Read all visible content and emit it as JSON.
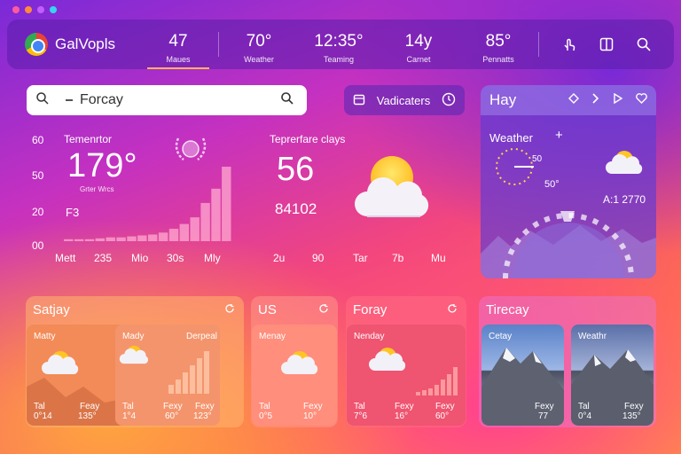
{
  "window_controls": {
    "colors": [
      "#ff5aa0",
      "#ff8a3c",
      "#c45cff",
      "#38d3f0"
    ]
  },
  "header": {
    "brand": "GalVopls",
    "stats": [
      {
        "value": "47",
        "label": "Maues",
        "active": true
      },
      {
        "value": "70°",
        "label": "Weather"
      },
      {
        "value": "12:35°",
        "label": "Teaming"
      },
      {
        "value": "14y",
        "label": "Carnet"
      },
      {
        "value": "85°",
        "label": "Pennatts"
      }
    ],
    "icons": [
      "hand-pointer-icon",
      "panel-icon",
      "search-icon"
    ]
  },
  "search": {
    "value": "Forcay"
  },
  "indicators_button": {
    "label": "Vadicaters"
  },
  "temperature_card": {
    "title": "Temenrtor",
    "value": "179°",
    "caption": "Grter Wrcs",
    "unit_label": "F3",
    "y_ticks": [
      "60",
      "50",
      "20",
      "00"
    ],
    "x_ticks": [
      "Mett",
      "235",
      "Mio",
      "30s",
      "Mly"
    ],
    "bars": [
      2,
      2,
      2,
      3,
      4,
      4,
      5,
      6,
      7,
      9,
      13,
      18,
      25,
      40,
      55,
      78
    ],
    "badge_icon": "laurel-sun-icon"
  },
  "temperature_days": {
    "title": "Teprerfare clays",
    "value": "56",
    "sub": "84102",
    "x_ticks": [
      "2u",
      "90",
      "Tar",
      "7b",
      "Mu"
    ],
    "weather_icon": "partly-cloudy-icon"
  },
  "right_panel": {
    "title": "Hay",
    "subtitle": "Weather",
    "plus": "+",
    "dial_value": "50",
    "dial_value2": "50°",
    "reading": "A:1 2770",
    "icons": [
      "diamond-icon",
      "chevron-right-icon",
      "play-icon",
      "heart-icon"
    ],
    "gauge_level": 0.62
  },
  "cards": [
    {
      "title": "Satjay",
      "panels": [
        {
          "title": "Matty",
          "footer": [
            [
              "Tal",
              "0°14"
            ],
            [
              "Feay",
              "135°"
            ]
          ],
          "accent": "#f08a50"
        },
        {
          "title": "Mady",
          "title2": "Derpeal",
          "footer": [
            [
              "Tal",
              "1°4"
            ],
            [
              "Fexy",
              "60°"
            ],
            [
              "Fexy",
              "123°"
            ]
          ],
          "accent": "#f4926a"
        }
      ]
    },
    {
      "title": "US",
      "panels": [
        {
          "title": "Menay",
          "footer": [
            [
              "Tal",
              "0°5"
            ],
            [
              "Fexy",
              "10°"
            ]
          ],
          "accent": "#ff8a7a"
        }
      ]
    },
    {
      "title": "Foray",
      "panels": [
        {
          "title": "Nenday",
          "footer": [
            [
              "Tal",
              "7°6"
            ],
            [
              "Fexy",
              "16°"
            ],
            [
              "Fexy",
              "60°"
            ]
          ],
          "accent": "#f0506a"
        }
      ]
    },
    {
      "title": "Tirecay",
      "panels": [
        {
          "title": "Cetay",
          "footer": [
            [
              "Fexy",
              "77"
            ]
          ]
        },
        {
          "title": "Weathr",
          "footer": [
            [
              "Tal",
              "0°4"
            ],
            [
              "Fexy",
              "135°"
            ]
          ]
        }
      ]
    }
  ]
}
